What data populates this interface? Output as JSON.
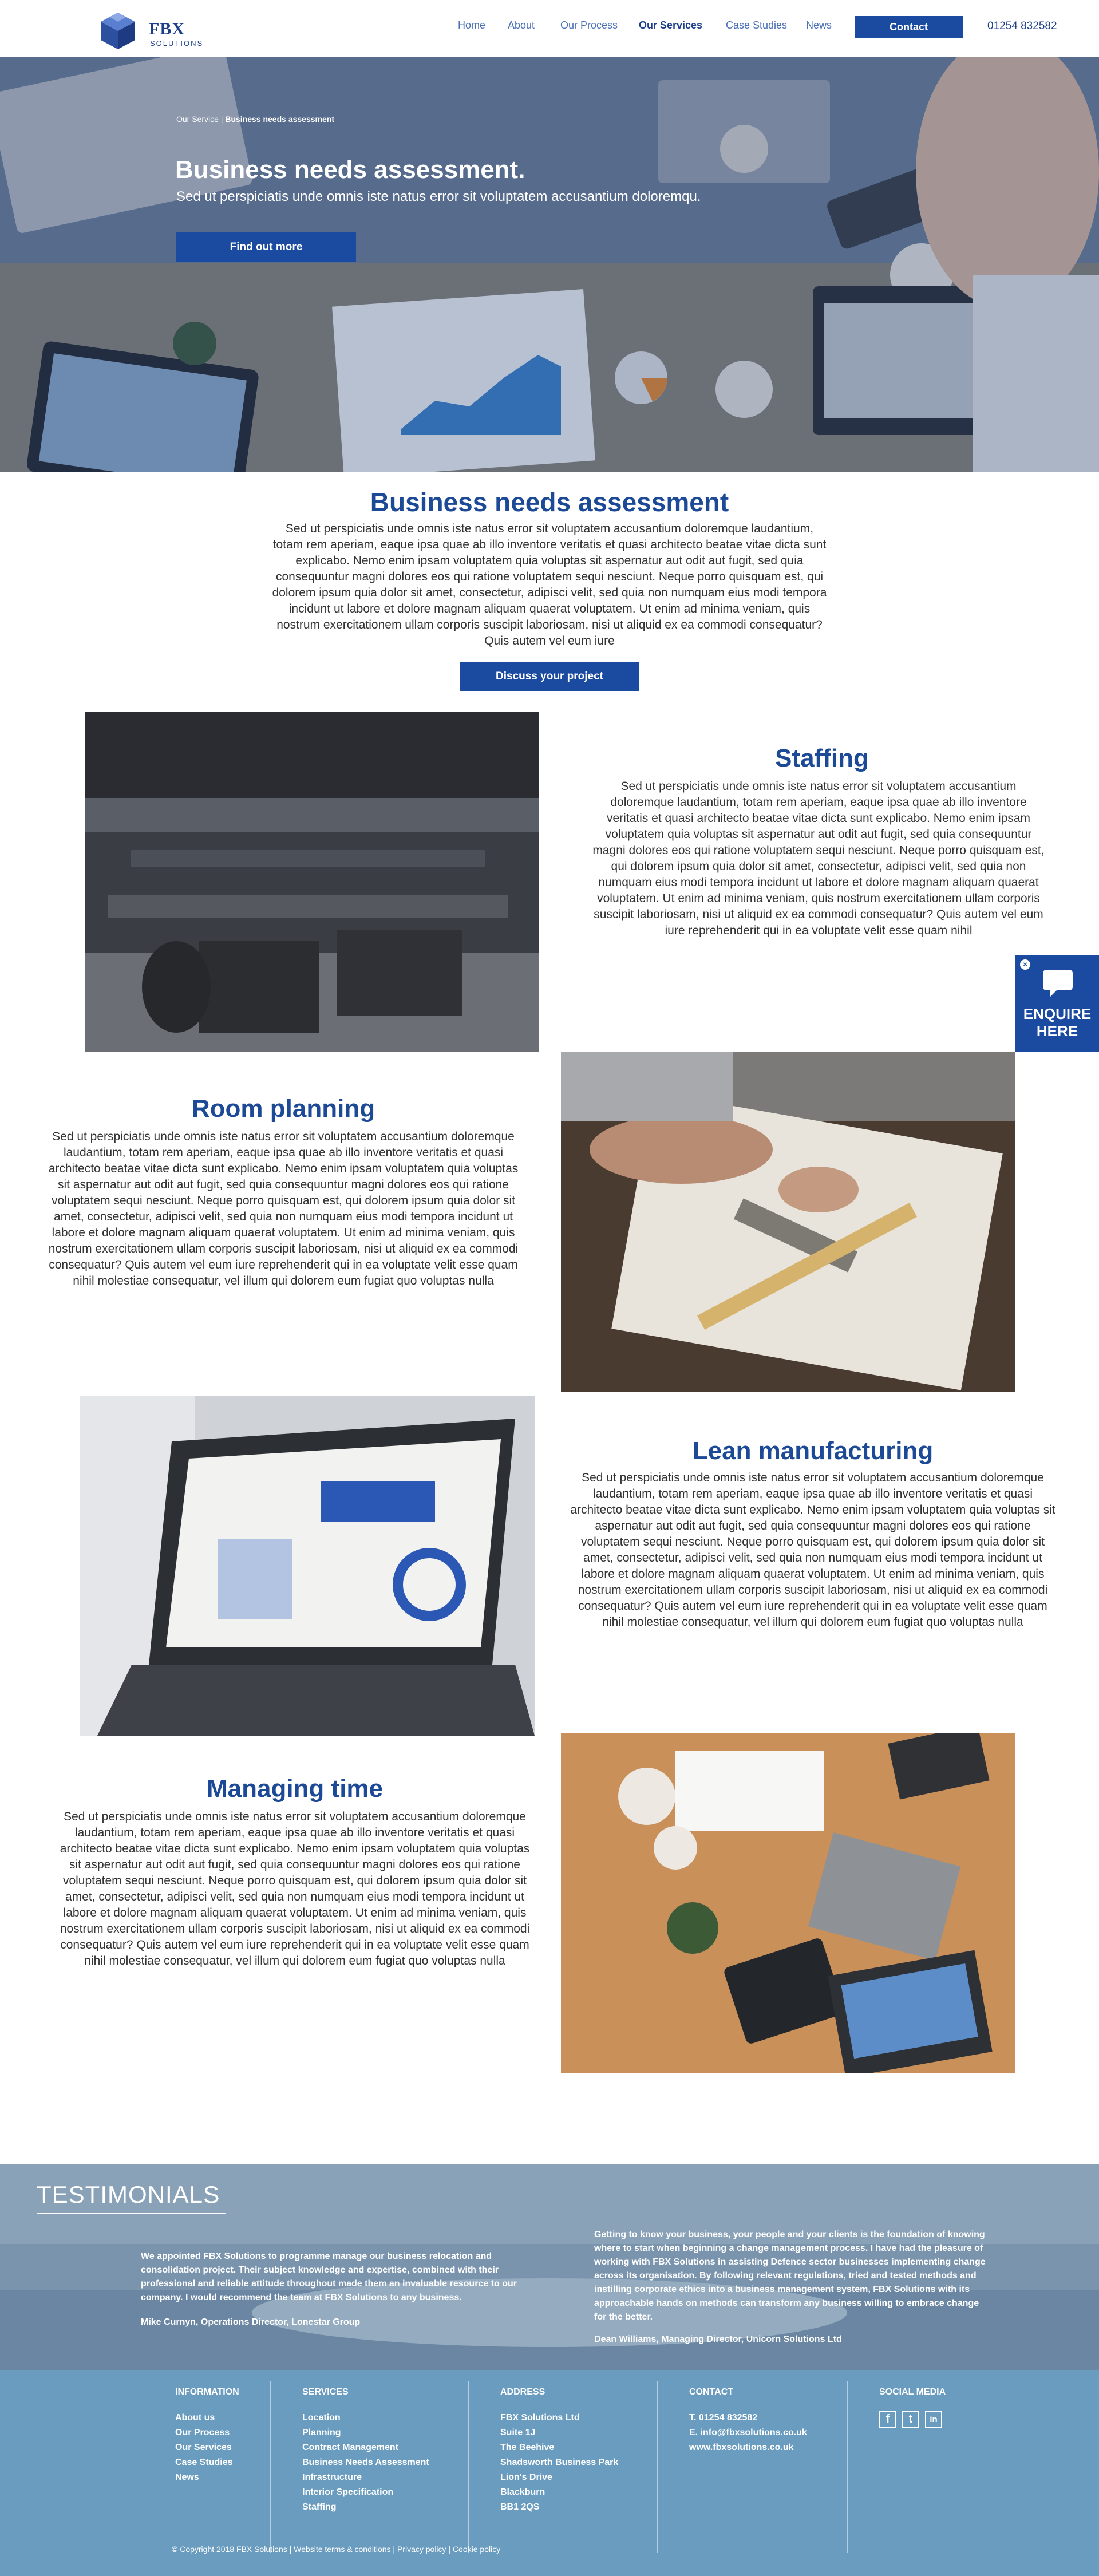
{
  "header": {
    "brand_name": "FBX",
    "brand_sub": "SOLUTIONS",
    "nav": [
      {
        "label": "Home"
      },
      {
        "label": "About"
      },
      {
        "label": "Our Process"
      },
      {
        "label": "Our Services"
      },
      {
        "label": "Case Studies"
      },
      {
        "label": "News"
      }
    ],
    "active_nav": "Our Services",
    "contact_label": "Contact",
    "phone": "01254 832582"
  },
  "hero": {
    "breadcrumb_parent": "Our Service |",
    "breadcrumb_current": "Business needs assessment",
    "title": "Business needs assessment.",
    "subtitle": "Sed ut perspiciatis unde omnis iste natus error sit voluptatem accusantium doloremqu.",
    "cta_label": "Find out more"
  },
  "intro": {
    "title": "Business needs  assessment",
    "text": "Sed ut perspiciatis unde omnis iste natus error sit voluptatem accusantium doloremque laudantium, totam rem aperiam, eaque ipsa quae ab illo inventore veritatis et quasi architecto beatae vitae dicta sunt explicabo. Nemo enim ipsam voluptatem quia voluptas sit aspernatur aut odit aut fugit, sed quia consequuntur magni dolores eos qui ratione voluptatem sequi nesciunt. Neque porro quisquam est, qui dolorem ipsum quia dolor sit amet, consectetur, adipisci velit, sed quia non numquam eius modi tempora incidunt ut labore et dolore magnam aliquam quaerat voluptatem. Ut enim ad minima veniam, quis nostrum exercitationem ullam corporis suscipit laboriosam, nisi ut aliquid ex ea commodi consequatur? Quis autem vel eum iure",
    "cta_label": "Discuss your project"
  },
  "sections": [
    {
      "title": "Staffing",
      "text": "Sed ut perspiciatis unde omnis iste natus error sit voluptatem accusantium doloremque laudantium, totam rem aperiam, eaque ipsa quae ab illo inventore veritatis et quasi architecto beatae vitae dicta sunt explicabo. Nemo enim ipsam voluptatem quia voluptas sit aspernatur aut odit aut fugit, sed quia consequuntur magni dolores eos qui ratione voluptatem sequi nesciunt. Neque porro quisquam est, qui dolorem ipsum quia dolor sit amet, consectetur, adipisci velit, sed quia non numquam eius modi tempora incidunt ut labore et dolore magnam aliquam quaerat voluptatem. Ut enim ad minima veniam, quis nostrum exercitationem ullam corporis suscipit laboriosam, nisi ut aliquid ex ea commodi consequatur? Quis autem vel eum iure reprehenderit qui in ea voluptate velit esse quam nihil"
    },
    {
      "title": "Room  planning",
      "text": "Sed ut perspiciatis unde omnis iste natus error sit voluptatem accusantium doloremque laudantium, totam rem aperiam, eaque ipsa quae ab illo inventore veritatis et quasi architecto beatae vitae dicta sunt explicabo. Nemo enim ipsam voluptatem quia voluptas sit aspernatur aut odit aut fugit, sed quia consequuntur magni dolores eos qui ratione voluptatem sequi nesciunt. Neque porro quisquam est, qui dolorem ipsum quia dolor sit amet, consectetur, adipisci velit, sed quia non numquam eius modi tempora incidunt ut labore et dolore magnam aliquam quaerat voluptatem. Ut enim ad minima veniam, quis nostrum exercitationem ullam corporis suscipit laboriosam, nisi ut aliquid ex ea commodi consequatur? Quis autem vel eum iure reprehenderit qui in ea voluptate velit esse quam nihil molestiae consequatur, vel illum qui dolorem eum fugiat quo voluptas nulla"
    },
    {
      "title": "Lean manufacturing",
      "text": "Sed ut perspiciatis unde omnis iste natus error sit voluptatem accusantium doloremque laudantium, totam rem aperiam, eaque ipsa quae ab illo inventore veritatis et quasi architecto beatae vitae dicta sunt explicabo. Nemo enim ipsam voluptatem quia voluptas sit aspernatur aut odit aut fugit, sed quia consequuntur magni dolores eos qui ratione voluptatem sequi nesciunt. Neque porro quisquam est, qui dolorem ipsum quia dolor sit amet, consectetur, adipisci velit, sed quia non numquam eius modi tempora incidunt ut labore et dolore magnam aliquam quaerat voluptatem. Ut enim ad minima veniam, quis nostrum exercitationem ullam corporis suscipit laboriosam, nisi ut aliquid ex ea commodi consequatur? Quis autem vel eum iure reprehenderit qui in ea voluptate velit esse quam nihil molestiae consequatur, vel illum qui dolorem eum fugiat quo voluptas nulla"
    },
    {
      "title": "Managing  time",
      "text": "Sed ut perspiciatis unde omnis iste natus error sit voluptatem accusantium doloremque laudantium, totam rem aperiam, eaque ipsa quae ab illo inventore veritatis et quasi architecto beatae vitae dicta sunt explicabo. Nemo enim ipsam voluptatem quia voluptas sit aspernatur aut odit aut fugit, sed quia consequuntur magni dolores eos qui ratione voluptatem sequi nesciunt. Neque porro quisquam est, qui dolorem ipsum quia dolor sit amet, consectetur, adipisci velit, sed quia non numquam eius modi tempora incidunt ut labore et dolore magnam aliquam quaerat voluptatem. Ut enim ad minima veniam, quis nostrum exercitationem ullam corporis suscipit laboriosam, nisi ut aliquid ex ea commodi consequatur? Quis autem vel eum iure reprehenderit qui in ea voluptate velit esse quam nihil molestiae consequatur, vel illum qui dolorem eum fugiat quo voluptas nulla"
    }
  ],
  "enquire": {
    "line1": "ENQUIRE",
    "line2": "HERE",
    "close": "×"
  },
  "testimonials": {
    "title": "TESTIMONIALS",
    "arrow": "›",
    "quotes": [
      {
        "text": "We appointed FBX Solutions to programme manage our business relocation and consolidation project. Their subject knowledge and expertise, combined with their professional and reliable attitude throughout made them an invaluable resource to our company. I would recommend the team at FBX Solutions to any business.",
        "author": "Mike Curnyn, Operations Director, Lonestar Group"
      },
      {
        "text": "Getting to know your business, your people and your clients is the foundation of knowing where to start when beginning a change management process. I have had the pleasure of working with FBX Solutions in assisting Defence sector businesses implementing change across its organisation. By following relevant regulations, tried and tested methods and instilling corporate ethics into a business management system, FBX Solutions with its approachable hands on methods can transform any business willing to embrace change for the better.",
        "author": "Dean Williams, Managing Director, Unicorn Solutions Ltd"
      }
    ]
  },
  "footer": {
    "information": {
      "heading": "INFORMATION",
      "items": [
        "About us",
        "Our Process",
        "Our Services",
        "Case Studies",
        "News"
      ]
    },
    "services": {
      "heading": "SERVICES",
      "items": [
        "Location",
        "Planning",
        "Contract Management",
        "Business Needs Assessment",
        "Infrastructure",
        "Interior Specification",
        "Staffing"
      ]
    },
    "address": {
      "heading": "ADDRESS",
      "items": [
        "FBX Solutions Ltd",
        "Suite 1J",
        "The Beehive",
        "Shadsworth Business Park",
        "Lion's Drive",
        "Blackburn",
        "BB1 2QS"
      ]
    },
    "contact": {
      "heading": "CONTACT",
      "items": [
        "T. 01254 832582",
        "E. info@fbxsolutions.co.uk",
        "www.fbxsolutions.co.uk"
      ]
    },
    "social": {
      "heading": "SOCIAL MEDIA",
      "icons": [
        {
          "name": "facebook-icon",
          "glyph": "f"
        },
        {
          "name": "twitter-icon",
          "glyph": "t"
        },
        {
          "name": "linkedin-icon",
          "glyph": "in"
        }
      ]
    },
    "copyright": "© Copyright 2018 FBX Solutions | Website terms & conditions | Privacy policy | Cookie policy"
  },
  "colors": {
    "brand": "#1a4ba0",
    "heading": "#1d4a96",
    "footer": "#6a9cc0"
  }
}
